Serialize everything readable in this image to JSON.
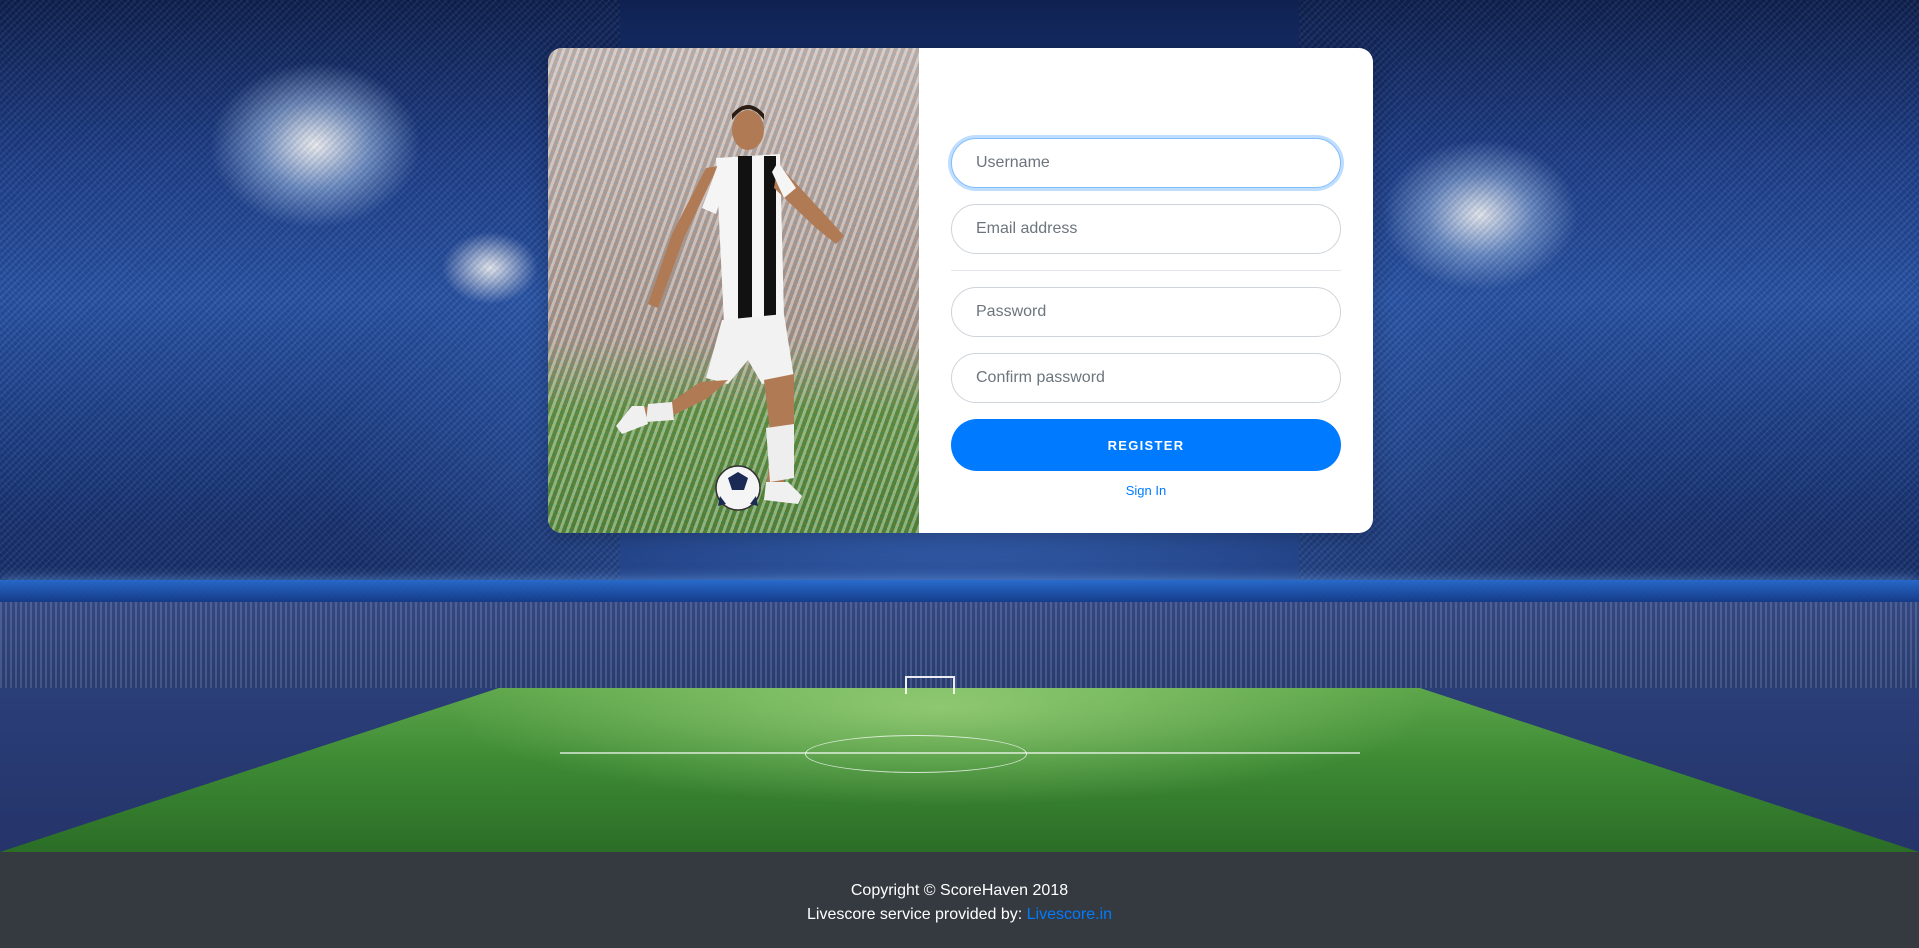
{
  "form": {
    "username_placeholder": "Username",
    "email_placeholder": "Email address",
    "password_placeholder": "Password",
    "confirm_password_placeholder": "Confirm password",
    "register_label": "REGISTER",
    "signin_label": "Sign In"
  },
  "footer": {
    "copyright": "Copyright © ScoreHaven 2018",
    "provider_prefix": "Livescore service provided by: ",
    "provider_link": "Livescore.in"
  },
  "colors": {
    "primary": "#007bff",
    "footer_bg": "#343a40",
    "card_bg": "#ffffff"
  },
  "images": {
    "background": "stadium-background",
    "card": "footballer-kicking-ball-photo"
  }
}
